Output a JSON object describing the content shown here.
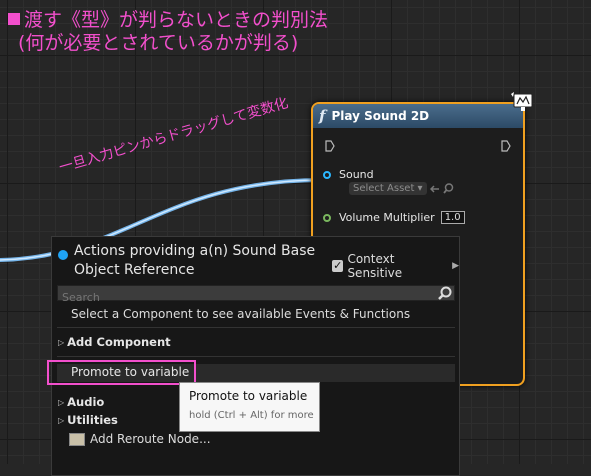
{
  "heading": {
    "line1": "渡す《型》が判らないときの判別法",
    "line2": "(何が必要とされているかが判る)"
  },
  "annotation": "一旦入力ピンからドラッグして変数化",
  "node": {
    "title": "Play Sound 2D",
    "pins": {
      "sound_label": "Sound",
      "sound_value": "Select Asset",
      "volume_label": "Volume Multiplier",
      "volume_value": "1.0"
    }
  },
  "menu": {
    "title_line1": "Actions providing a(n) Sound Base",
    "title_line2": "Object Reference",
    "context_sensitive_label": "Context Sensitive",
    "context_sensitive_checked": true,
    "search_placeholder": "Search",
    "hint": "Select a Component to see available Events & Functions",
    "items": {
      "add_component": "Add Component",
      "promote": "Promote to variable",
      "audio": "Audio",
      "utilities": "Utilities",
      "reroute": "Add Reroute Node..."
    }
  },
  "tooltip": {
    "title": "Promote to variable",
    "shortcut": "hold (Ctrl + Alt) for more"
  },
  "colors": {
    "accent_pink": "#f24fcc",
    "node_border": "#f0a020",
    "object_pin": "#2bb7ff",
    "float_pin": "#7ab75e"
  }
}
